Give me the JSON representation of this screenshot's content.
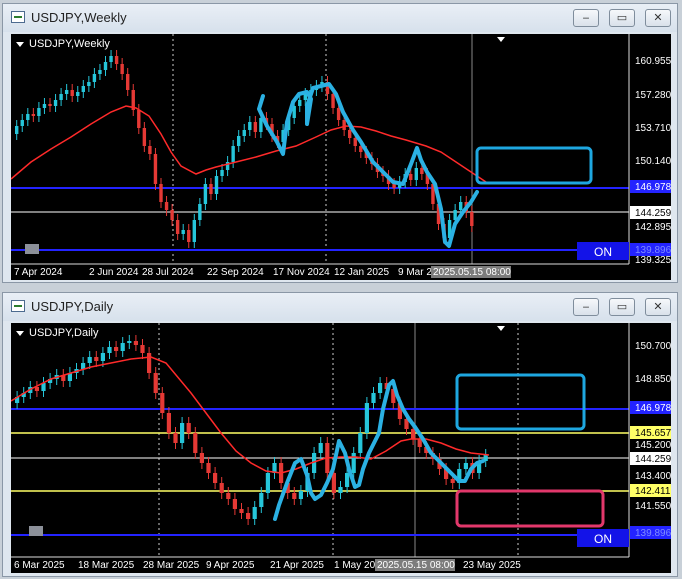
{
  "weekly": {
    "window_title": "USDJPY,Weekly",
    "chart_label": "USDJPY,Weekly",
    "price_labels": [
      "160.955",
      "157.280",
      "153.710",
      "150.140",
      "146.978",
      "144.259",
      "142.895",
      "139.325",
      "139.896"
    ],
    "date_labels": [
      "7 Apr 2024",
      "2 Jun 2024",
      "28 Jul 2024",
      "22 Sep 2024",
      "17 Nov 2024",
      "12 Jan 2025",
      "9 Mar 2",
      "2025.05.15 08:00"
    ],
    "on_label": "ON"
  },
  "daily": {
    "window_title": "USDJPY,Daily",
    "chart_label": "USDJPY,Daily",
    "price_labels": [
      "150.700",
      "148.850",
      "146.978",
      "145.657",
      "145.200",
      "144.259",
      "143.400",
      "142.411",
      "141.550",
      "139.896"
    ],
    "date_labels": [
      "6 Mar 2025",
      "18 Mar 2025",
      "28 Mar 2025",
      "9 Apr 2025",
      "21 Apr 2025",
      "1 May 20",
      "2025.05.15 08:00",
      "23 May 2025"
    ],
    "on_label": "ON"
  },
  "window_buttons": {
    "minimize": "‒",
    "restore": "▭",
    "close": "✕"
  },
  "colors": {
    "background": "#000000",
    "bull": "#26c6da",
    "bear": "#e53935",
    "ma": "#ff2a2a",
    "box_blue": "#1ea7e0",
    "box_pink": "#e2386b",
    "hline_blue": "#2323ff",
    "hline_yellow": "#ffff66",
    "grid_white": "#ffffff"
  }
}
